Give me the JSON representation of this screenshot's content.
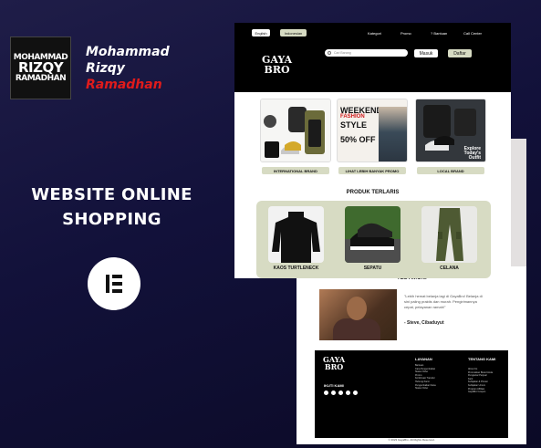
{
  "author": {
    "logo_lines": [
      "MOHAMMAD",
      "RIZQY",
      "RAMADHAN"
    ],
    "name_lines": [
      "Mohammad",
      "Rizqy",
      "Ramadhan"
    ],
    "accent": "#e01b1b"
  },
  "headline_lines": [
    "WEBSITE ONLINE",
    "SHOPPING"
  ],
  "builder_icon": "elementor-icon",
  "site": {
    "lang": {
      "en": "English",
      "id": "Indonesian"
    },
    "nav": [
      "Kategori",
      "Promo",
      "? Bantuan",
      "Call Center"
    ],
    "logo_lines": [
      "GAYA",
      "BRO"
    ],
    "search_placeholder": "Cari Barang",
    "login_label": "Masuk",
    "register_label": "Daftar",
    "categories": [
      {
        "label": "INTERNATIONAL BRAND"
      },
      {
        "label": "LIHAT LEBIH BANYAK PROMO",
        "banner": [
          "WEEKEND",
          "FASHION",
          "STYLE",
          "50% OFF"
        ]
      },
      {
        "label": "LOCAL BRAND",
        "banner": [
          "Explore",
          "Today's",
          "Outfit"
        ]
      }
    ],
    "products_title": "PRODUK TERLARIS",
    "products": [
      {
        "label": "KAOS TURTLENECK"
      },
      {
        "label": "SEPATU"
      },
      {
        "label": "CELANA"
      }
    ],
    "testimonial": {
      "title": "TESTIMONI",
      "quote": "\"Lebih hemat belanja lagi di GayaBro! Belanja di sini paling praktis dan murah. Pengirimannya cepat, pelayanan ramah!\"",
      "name": "- Steve, Cibaduyut"
    },
    "footer": {
      "columns": [
        {
          "title": "LAYANAN",
          "items": [
            "Bantuan",
            "Cara Pengembalian",
            "Status Order",
            "Promo",
            "Konfirmasi Transfer",
            "Hubungi Kami",
            "Pengembalian Dana",
            "Status Order"
          ]
        },
        {
          "title": "TENTANG KAMI",
          "items": [
            "About Us",
            "Promosikan Brand Anda",
            "Pengantar Penjual",
            "Karir",
            "Kebijakan & Privasi",
            "Kebijakan Umum",
            "Program Affiliasi",
            "GayaBro Coupon"
          ]
        }
      ],
      "follow_label": "IKUTI KAMI",
      "copyright": "© 2023 GayaBro. All Rights Reserved."
    }
  }
}
